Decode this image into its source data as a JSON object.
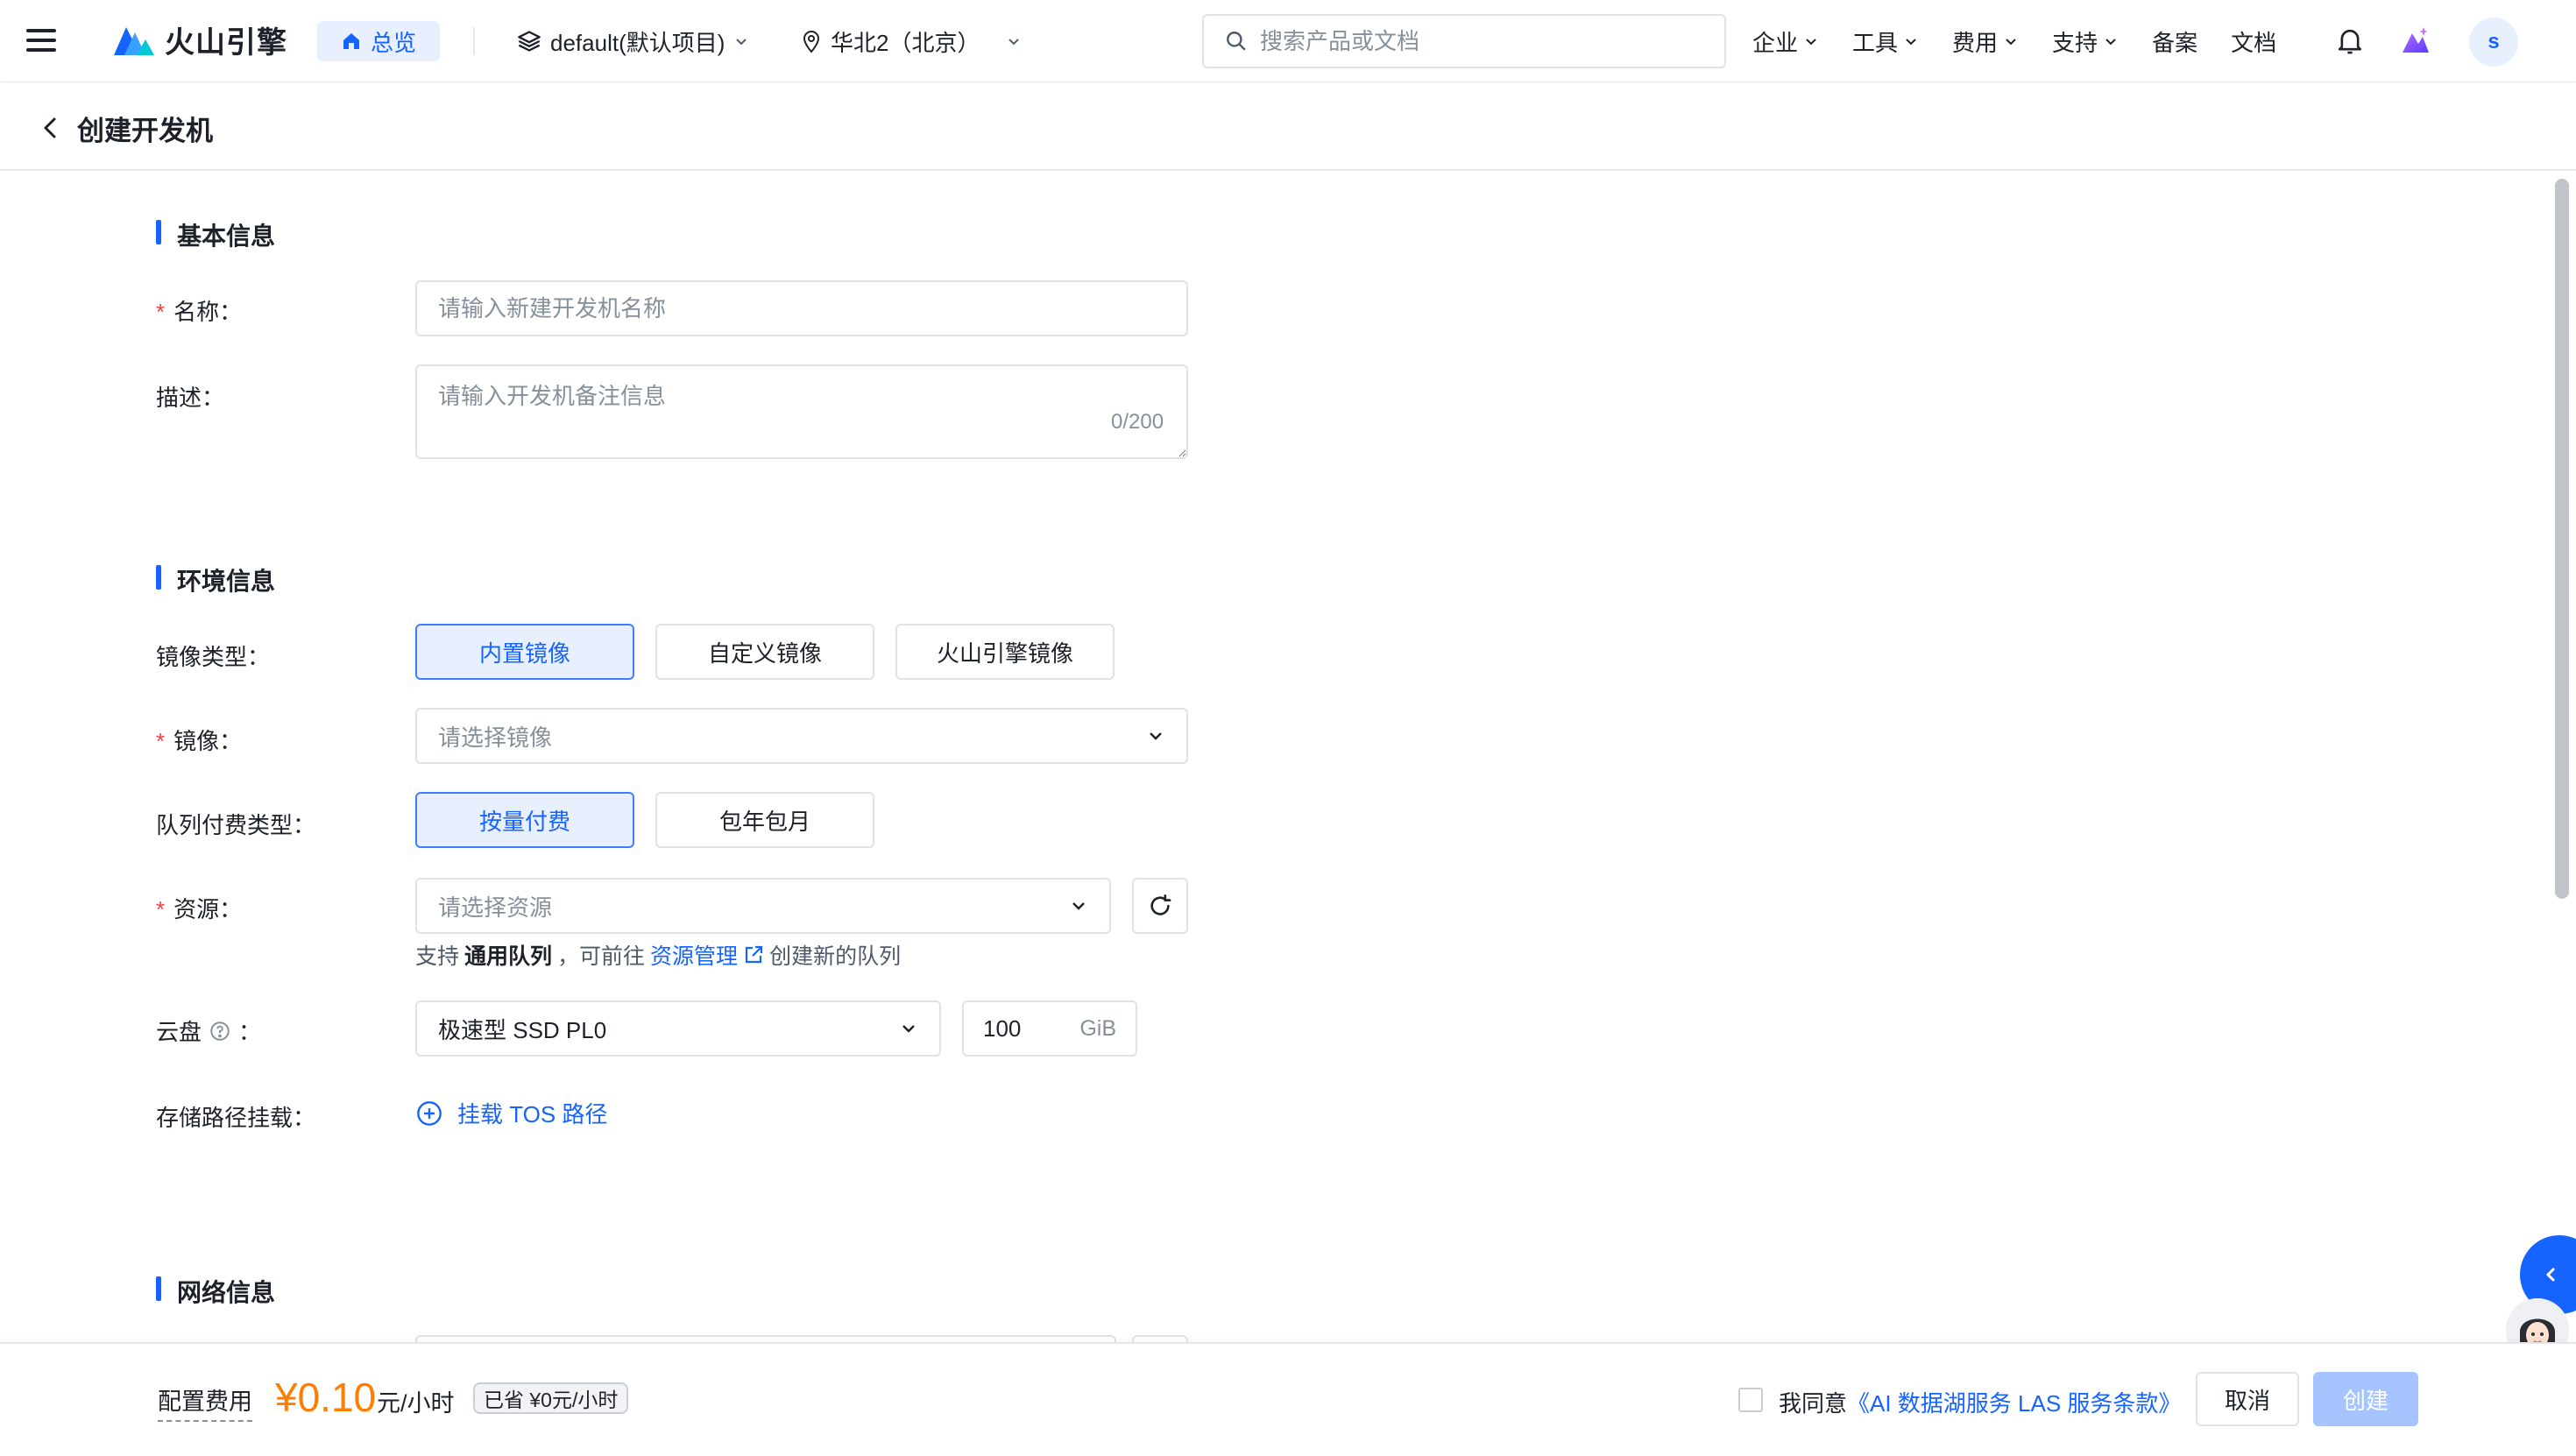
{
  "topnav": {
    "logo_text": "火山引擎",
    "home_label": "总览",
    "project": "default(默认项目)",
    "region": "华北2（北京）",
    "search_placeholder": "搜索产品或文档",
    "links": [
      {
        "label": "企业",
        "dropdown": true
      },
      {
        "label": "工具",
        "dropdown": true
      },
      {
        "label": "费用",
        "dropdown": true
      },
      {
        "label": "支持",
        "dropdown": true
      },
      {
        "label": "备案",
        "dropdown": false
      },
      {
        "label": "文档",
        "dropdown": false
      }
    ],
    "avatar_letter": "s",
    "accent": "#1664ff"
  },
  "page": {
    "title": "创建开发机"
  },
  "basic": {
    "section_title": "基本信息",
    "name_label": "名称：",
    "name_placeholder": "请输入新建开发机名称",
    "desc_label": "描述：",
    "desc_placeholder": "请输入开发机备注信息",
    "desc_counter": "0/200"
  },
  "env": {
    "section_title": "环境信息",
    "image_type_label": "镜像类型：",
    "image_types": [
      "内置镜像",
      "自定义镜像",
      "火山引擎镜像"
    ],
    "image_type_selected": 0,
    "image_label": "镜像：",
    "image_placeholder": "请选择镜像",
    "billing_label": "队列付费类型：",
    "billing_types": [
      "按量付费",
      "包年包月"
    ],
    "billing_selected": 0,
    "resource_label": "资源：",
    "resource_placeholder": "请选择资源",
    "resource_hint_prefix": "支持",
    "resource_hint_bold": "通用队列",
    "resource_hint_mid": "，可前往",
    "resource_hint_link": "资源管理",
    "resource_hint_suffix": "创建新的队列",
    "disk_label": "云盘",
    "disk_colon": "：",
    "disk_type": "极速型 SSD PL0",
    "disk_size": "100",
    "disk_unit": "GiB",
    "mount_label": "存储路径挂载：",
    "mount_action": "挂载 TOS 路径"
  },
  "network": {
    "section_title": "网络信息"
  },
  "footer": {
    "fee_label": "配置费用",
    "price": "¥0.10",
    "price_unit": "元/小时",
    "saved": "已省 ¥0元/小时",
    "agree_prefix": "我同意",
    "agree_link": "《AI 数据湖服务 LAS 服务条款》",
    "cancel_label": "取消",
    "create_label": "创建",
    "price_color": "#ff7d00"
  }
}
